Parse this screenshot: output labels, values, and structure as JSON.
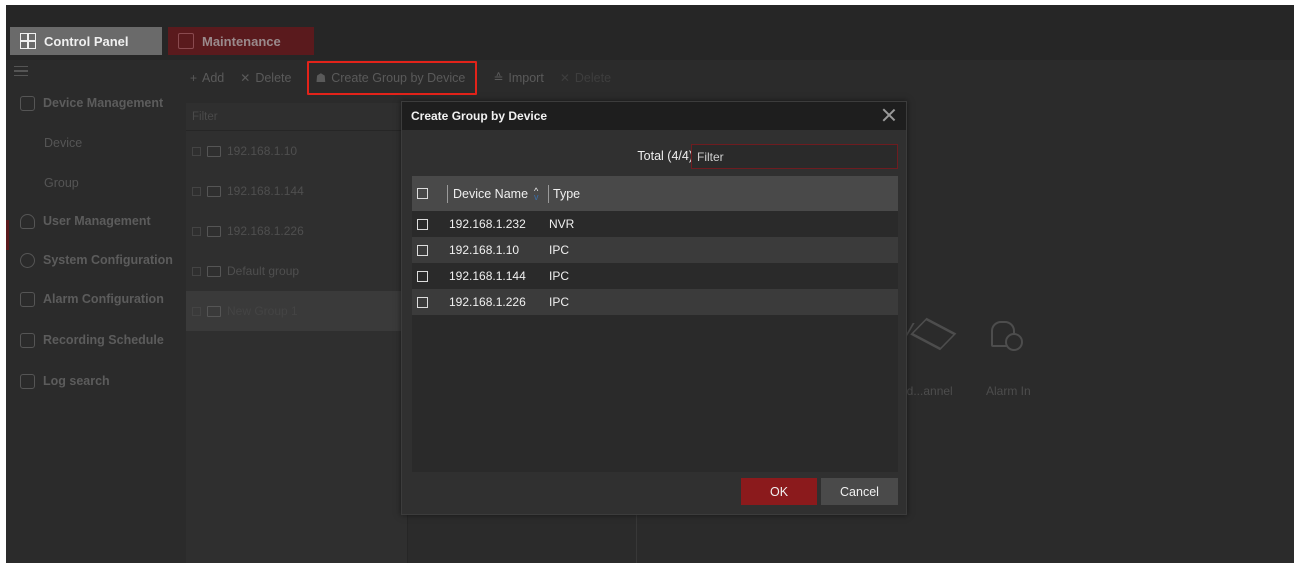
{
  "tabs": [
    {
      "label": "Control Panel",
      "icon": "grid-icon",
      "active": true
    },
    {
      "label": "Maintenance",
      "icon": "wrench-icon",
      "active": false
    }
  ],
  "sidebar": {
    "items": [
      {
        "label": "Device Management",
        "icon": "device-management-icon"
      },
      {
        "label": "Device",
        "sub": true
      },
      {
        "label": "Group",
        "sub": true
      },
      {
        "label": "User Management",
        "icon": "user-icon"
      },
      {
        "label": "System Configuration",
        "icon": "gear-icon"
      },
      {
        "label": "Alarm Configuration",
        "icon": "alarm-icon"
      },
      {
        "label": "Recording Schedule",
        "icon": "calendar-icon"
      },
      {
        "label": "Log search",
        "icon": "log-icon"
      }
    ]
  },
  "toolbar": {
    "add": "Add",
    "delete": "Delete",
    "create_group": "Create Group by Device",
    "import": "Import",
    "delete2": "Delete"
  },
  "group_panel": {
    "filter_placeholder": "Filter",
    "groups": [
      "192.168.1.10",
      "192.168.1.144",
      "192.168.1.226",
      "Default group",
      "New Group 1"
    ]
  },
  "right_icons": {
    "partial_label": "od...annel",
    "alarm_in": "Alarm In"
  },
  "dialog": {
    "title": "Create Group by Device",
    "total": "Total (4/4)",
    "filter_placeholder": "Filter",
    "columns": {
      "name": "Device Name",
      "type": "Type"
    },
    "rows": [
      {
        "name": "192.168.1.232",
        "type": "NVR"
      },
      {
        "name": "192.168.1.10",
        "type": "IPC"
      },
      {
        "name": "192.168.1.144",
        "type": "IPC"
      },
      {
        "name": "192.168.1.226",
        "type": "IPC"
      }
    ],
    "ok": "OK",
    "cancel": "Cancel"
  },
  "colors": {
    "accent": "#8b1a1c",
    "highlight_box": "#e2231a",
    "background": "#2b2b2b"
  }
}
